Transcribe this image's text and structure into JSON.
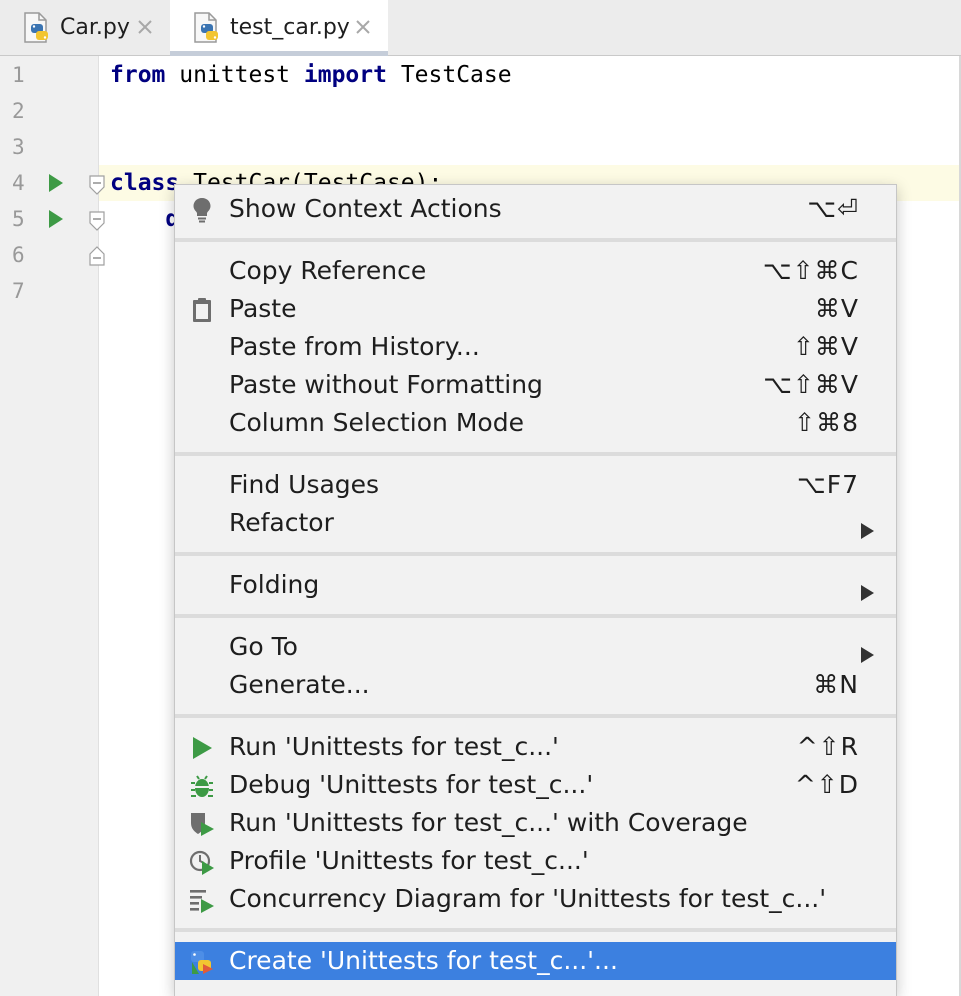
{
  "tabs": [
    {
      "label": "Car.py",
      "active": false
    },
    {
      "label": "test_car.py",
      "active": true
    }
  ],
  "editor": {
    "line_numbers": [
      "1",
      "2",
      "3",
      "4",
      "5",
      "6",
      "7"
    ],
    "code": {
      "line1": {
        "kw1": "from",
        "mid": " unittest ",
        "kw2": "import",
        "rest": " TestCase"
      },
      "line4": {
        "kw": "class",
        "rest": " TestCar(TestCase):"
      },
      "line5": {
        "rest": "    d"
      }
    }
  },
  "context_menu": {
    "items": [
      {
        "label": "Show Context Actions",
        "shortcut": "⌥⏎",
        "icon": "lightbulb-icon"
      },
      {
        "label": "Copy Reference",
        "shortcut": "⌥⇧⌘C"
      },
      {
        "label": "Paste",
        "shortcut": "⌘V",
        "icon": "clipboard-icon"
      },
      {
        "label": "Paste from History...",
        "shortcut": "⇧⌘V"
      },
      {
        "label": "Paste without Formatting",
        "shortcut": "⌥⇧⌘V"
      },
      {
        "label": "Column Selection Mode",
        "shortcut": "⇧⌘8"
      },
      {
        "label": "Find Usages",
        "shortcut": "⌥F7"
      },
      {
        "label": "Refactor",
        "submenu": true
      },
      {
        "label": "Folding",
        "submenu": true
      },
      {
        "label": "Go To",
        "submenu": true
      },
      {
        "label": "Generate...",
        "shortcut": "⌘N"
      },
      {
        "label": "Run 'Unittests for test_c...'",
        "shortcut": "^⇧R",
        "icon": "run-icon"
      },
      {
        "label": "Debug 'Unittests for test_c...'",
        "shortcut": "^⇧D",
        "icon": "debug-icon"
      },
      {
        "label": "Run 'Unittests for test_c...' with Coverage",
        "icon": "coverage-icon"
      },
      {
        "label": "Profile 'Unittests for test_c...'",
        "icon": "profile-icon"
      },
      {
        "label": "Concurrency Diagram for 'Unittests for test_c...'",
        "icon": "concurrency-diagram-icon"
      },
      {
        "label": "Create 'Unittests for test_c...'...",
        "icon": "python-config-icon",
        "selected": true
      }
    ]
  },
  "colors": {
    "selection": "#3c80e0",
    "keyword": "#000080",
    "run_green": "#3d9a45"
  }
}
